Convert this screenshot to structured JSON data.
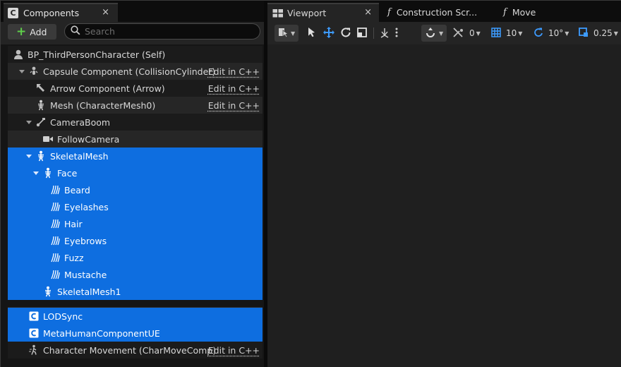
{
  "components_panel": {
    "tab_label": "Components",
    "tab_icon": "C",
    "close_glyph": "×",
    "add_label": "Add",
    "search_placeholder": "Search",
    "edit_label": "Edit in C++",
    "rows": [
      {
        "label": "BP_ThirdPersonCharacter (Self)",
        "icon": "character-icon"
      },
      {
        "label": "Capsule Component (CollisionCylinder)",
        "icon": "capsule-icon",
        "edit": true
      },
      {
        "label": "Arrow Component (Arrow)",
        "icon": "arrow-component-icon",
        "edit": true
      },
      {
        "label": "Mesh (CharacterMesh0)",
        "icon": "skeleton-icon",
        "edit": true
      },
      {
        "label": "CameraBoom",
        "icon": "spring-arm-icon"
      },
      {
        "label": "FollowCamera",
        "icon": "camera-icon"
      },
      {
        "label": "SkeletalMesh",
        "icon": "skeleton-icon",
        "selected": true
      },
      {
        "label": "Face",
        "icon": "skeleton-icon",
        "selected": true
      },
      {
        "label": "Beard",
        "icon": "groom-icon",
        "selected": true
      },
      {
        "label": "Eyelashes",
        "icon": "groom-icon",
        "selected": true
      },
      {
        "label": "Hair",
        "icon": "groom-icon",
        "selected": true
      },
      {
        "label": "Eyebrows",
        "icon": "groom-icon",
        "selected": true
      },
      {
        "label": "Fuzz",
        "icon": "groom-icon",
        "selected": true
      },
      {
        "label": "Mustache",
        "icon": "groom-icon",
        "selected": true
      },
      {
        "label": "SkeletalMesh1",
        "icon": "skeleton-icon",
        "selected": true
      },
      {
        "label": "LODSync",
        "icon": "c-component-icon",
        "selected": true
      },
      {
        "label": "MetaHumanComponentUE",
        "icon": "c-component-icon",
        "selected": true
      },
      {
        "label": "Character Movement (CharMoveComp)",
        "icon": "movement-icon",
        "edit": true
      }
    ]
  },
  "viewport_panel": {
    "tabs": [
      {
        "label": "Viewport",
        "icon": "viewport-icon"
      },
      {
        "label": "Construction Scr...",
        "icon": "function-icon"
      },
      {
        "label": "Move",
        "icon": "function-icon"
      }
    ],
    "function_glyph": "f",
    "toolbar": {
      "rotation_snap_value": "0",
      "grid_snap_value": "10",
      "angle_snap_value": "10°",
      "scale_snap_value": "0.25"
    }
  },
  "colors": {
    "selection": "#0e6ee0",
    "add_plus": "#5fcf4a",
    "gizmo_blue": "#3d9bff"
  }
}
